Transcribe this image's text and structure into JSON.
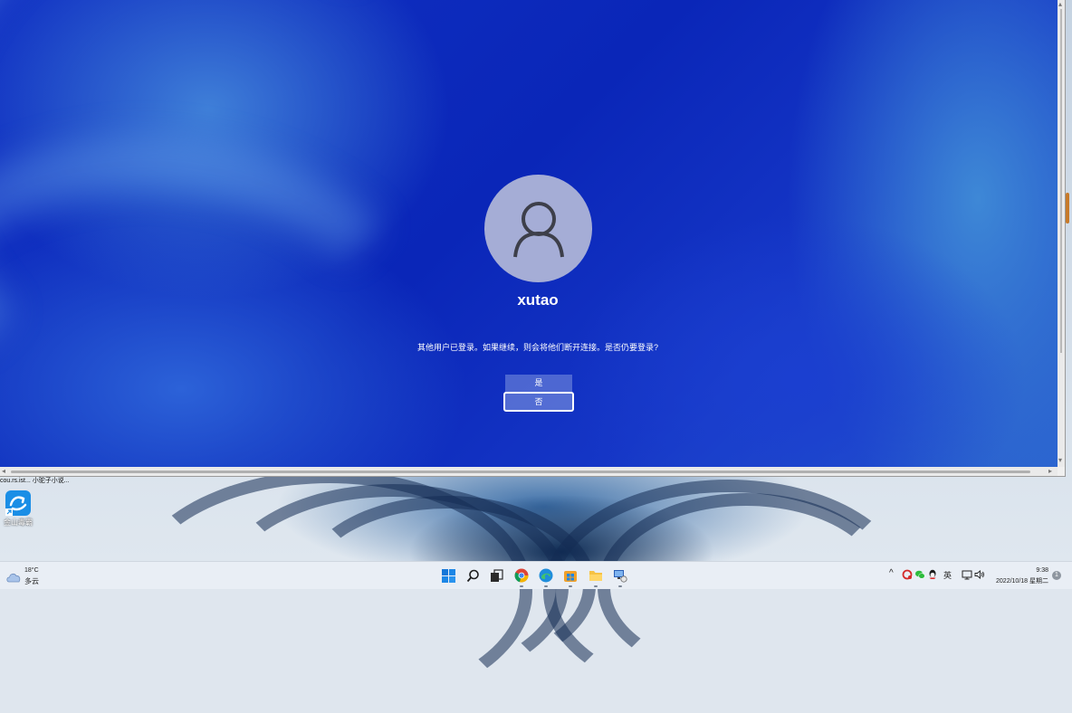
{
  "lock_screen": {
    "username": "xutao",
    "message": "其他用户已登录。如果继续，则会将他们断开连接。是否仍要登录?",
    "yes_label": "是",
    "no_label": "否",
    "avatar_icon": "user-icon",
    "avatar_color": "#a5add6"
  },
  "desktop": {
    "top_labels": "cou.rs.ist...   小驼子小说...",
    "shortcut_label": "金山毒霸",
    "shortcut_icon": "kingsoft-antivirus-icon"
  },
  "taskbar": {
    "weather": {
      "temp": "18°C",
      "desc": "多云",
      "icon": "cloud-icon"
    },
    "apps": [
      "start-icon",
      "search-icon",
      "task-view-icon",
      "chrome-icon",
      "edge-icon",
      "store-icon",
      "file-explorer-icon",
      "remote-desktop-icon"
    ],
    "tray": {
      "chevron": "^",
      "ime": "英"
    },
    "clock": {
      "time": "9:38",
      "date": "2022/10/18 星期二"
    },
    "notification_count": "1"
  }
}
